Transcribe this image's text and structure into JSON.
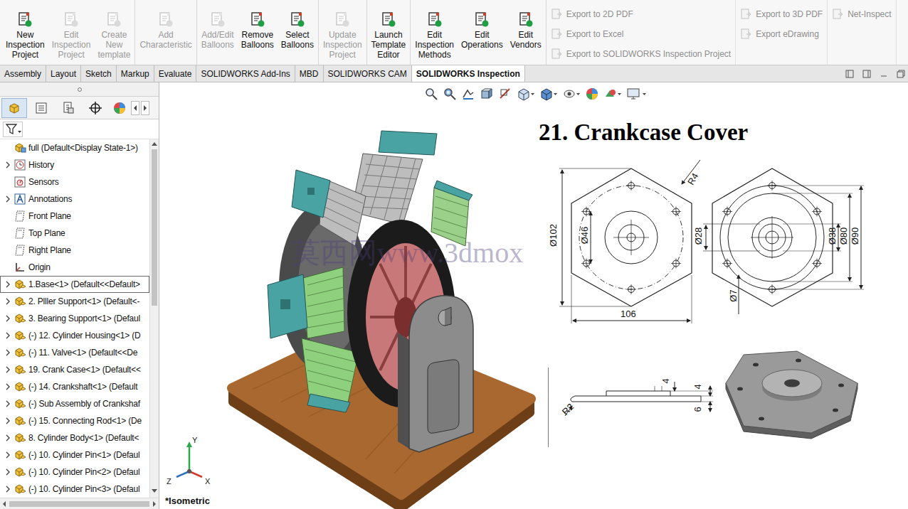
{
  "ribbon": {
    "groups": [
      [
        {
          "label": "New\nInspection\nProject",
          "disabled": false
        },
        {
          "label": "Edit\nInspection\nProject",
          "disabled": true
        },
        {
          "label": "Create\nNew\ntemplate",
          "disabled": true
        }
      ],
      [
        {
          "label": "Add\nCharacteristic",
          "disabled": true
        }
      ],
      [
        {
          "label": "Add/Edit\nBalloons",
          "disabled": true
        },
        {
          "label": "Remove\nBalloons",
          "disabled": false
        },
        {
          "label": "Select\nBalloons",
          "disabled": false
        }
      ],
      [
        {
          "label": "Update\nInspection\nProject",
          "disabled": true
        }
      ],
      [
        {
          "label": "Launch\nTemplate\nEditor",
          "disabled": false
        }
      ],
      [
        {
          "label": "Edit\nInspection\nMethods",
          "disabled": false
        },
        {
          "label": "Edit\nOperations",
          "disabled": false
        },
        {
          "label": "Edit\nVendors",
          "disabled": false
        }
      ]
    ],
    "exports": [
      [
        {
          "label": "Export to 2D PDF",
          "disabled": true
        },
        {
          "label": "Export to Excel",
          "disabled": true
        },
        {
          "label": "Export to SOLIDWORKS Inspection Project",
          "disabled": true
        }
      ],
      [
        {
          "label": "Export to 3D PDF",
          "disabled": true
        },
        {
          "label": "Export eDrawing",
          "disabled": true
        }
      ],
      [
        {
          "label": "Net-Inspect",
          "disabled": true
        }
      ]
    ]
  },
  "tabs": [
    {
      "label": "Assembly",
      "selected": false
    },
    {
      "label": "Layout",
      "selected": false
    },
    {
      "label": "Sketch",
      "selected": false
    },
    {
      "label": "Markup",
      "selected": false
    },
    {
      "label": "Evaluate",
      "selected": false
    },
    {
      "label": "SOLIDWORKS Add-Ins",
      "selected": false
    },
    {
      "label": "MBD",
      "selected": false
    },
    {
      "label": "SOLIDWORKS CAM",
      "selected": false
    },
    {
      "label": "SOLIDWORKS Inspection",
      "selected": true
    }
  ],
  "tree": {
    "items": [
      {
        "label": "full  (Default<Display State-1>)",
        "kind": "root",
        "expandable": false,
        "selected": false
      },
      {
        "label": "History",
        "kind": "history",
        "expandable": true,
        "selected": false
      },
      {
        "label": "Sensors",
        "kind": "sensors",
        "expandable": false,
        "selected": false
      },
      {
        "label": "Annotations",
        "kind": "annotations",
        "expandable": true,
        "selected": false
      },
      {
        "label": "Front Plane",
        "kind": "plane",
        "expandable": false,
        "selected": false
      },
      {
        "label": "Top Plane",
        "kind": "plane",
        "expandable": false,
        "selected": false
      },
      {
        "label": "Right Plane",
        "kind": "plane",
        "expandable": false,
        "selected": false
      },
      {
        "label": "Origin",
        "kind": "origin",
        "expandable": false,
        "selected": false
      },
      {
        "label": "1.Base<1> (Default<<Default>",
        "kind": "part",
        "expandable": true,
        "selected": true
      },
      {
        "label": "2. Plller Support<1> (Default<-",
        "kind": "part",
        "expandable": true,
        "selected": false
      },
      {
        "label": "3. Bearing Support<1> (Defaul",
        "kind": "part",
        "expandable": true,
        "selected": false
      },
      {
        "label": "(-) 12. Cylinder Housing<1> (D",
        "kind": "part",
        "expandable": true,
        "selected": false
      },
      {
        "label": "(-) 11. Valve<1> (Default<<De",
        "kind": "part",
        "expandable": true,
        "selected": false
      },
      {
        "label": "19. Crank Case<1> (Default<<",
        "kind": "part",
        "expandable": true,
        "selected": false
      },
      {
        "label": "(-) 14. Crankshaft<1> (Default",
        "kind": "part",
        "expandable": true,
        "selected": false
      },
      {
        "label": "(-) Sub Assembly of Crankshaf",
        "kind": "part",
        "expandable": true,
        "selected": false
      },
      {
        "label": "(-) 15. Connecting Rod<1> (De",
        "kind": "part",
        "expandable": true,
        "selected": false
      },
      {
        "label": "8. Cylinder Body<1> (Default<",
        "kind": "part",
        "expandable": true,
        "selected": false
      },
      {
        "label": "(-) 10. Cylinder Pin<1> (Defaul",
        "kind": "part",
        "expandable": true,
        "selected": false
      },
      {
        "label": "(-) 10. Cylinder Pin<2> (Defaul",
        "kind": "part",
        "expandable": true,
        "selected": false
      },
      {
        "label": "(-) 10. Cylinder Pin<3> (Defaul",
        "kind": "part",
        "expandable": true,
        "selected": false
      }
    ]
  },
  "viewport": {
    "view_label": "*Isometric",
    "watermark": "莫西网www.3dmox",
    "triad": [
      "Y",
      "Z",
      "X"
    ]
  },
  "drawing": {
    "title": "21. Crankcase Cover",
    "dims": [
      "R4",
      "Ø102",
      "Ø46",
      "106",
      "Ø28",
      "Ø38",
      "Ø80",
      "Ø90",
      "Ø7",
      "4",
      "4",
      "6",
      "R2"
    ]
  }
}
